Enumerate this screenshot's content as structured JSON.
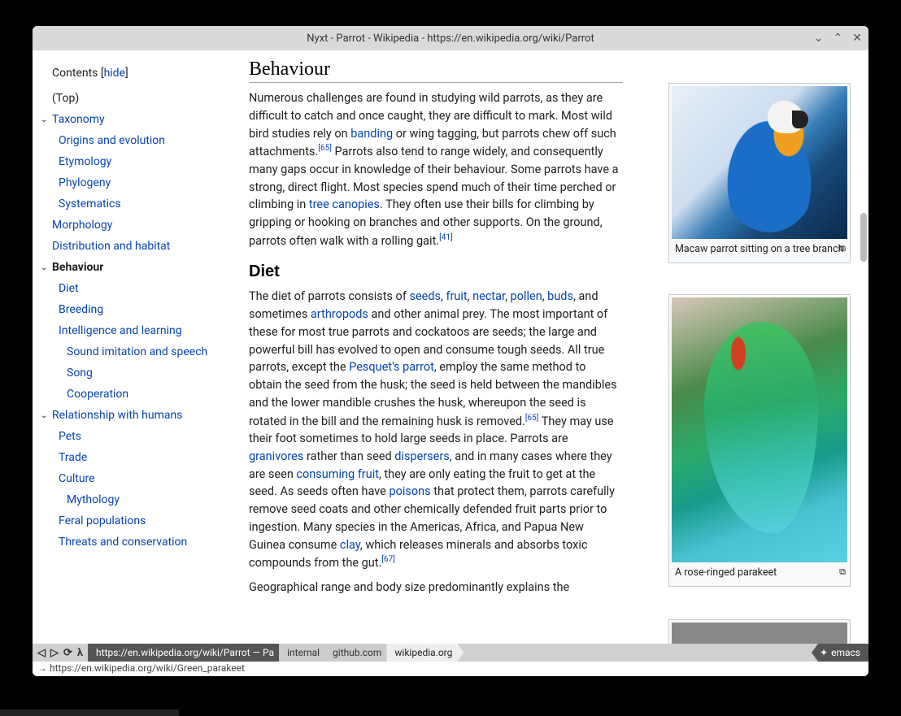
{
  "titlebar": "Nyxt - Parrot - Wikipedia - https://en.wikipedia.org/wiki/Parrot",
  "sidebar": {
    "header": "Contents",
    "hide": "hide",
    "items": [
      {
        "label": "(Top)",
        "lvl": 1,
        "arrow": false,
        "black": true
      },
      {
        "label": "Taxonomy",
        "lvl": 1,
        "arrow": true
      },
      {
        "label": "Origins and evolution",
        "lvl": 2
      },
      {
        "label": "Etymology",
        "lvl": 2
      },
      {
        "label": "Phylogeny",
        "lvl": 2
      },
      {
        "label": "Systematics",
        "lvl": 2
      },
      {
        "label": "Morphology",
        "lvl": 1
      },
      {
        "label": "Distribution and habitat",
        "lvl": 1
      },
      {
        "label": "Behaviour",
        "lvl": 1,
        "arrow": true,
        "bold": true
      },
      {
        "label": "Diet",
        "lvl": 2
      },
      {
        "label": "Breeding",
        "lvl": 2
      },
      {
        "label": "Intelligence and learning",
        "lvl": 2
      },
      {
        "label": "Sound imitation and speech",
        "lvl": 3
      },
      {
        "label": "Song",
        "lvl": 3
      },
      {
        "label": "Cooperation",
        "lvl": 3
      },
      {
        "label": "Relationship with humans",
        "lvl": 1,
        "arrow": true
      },
      {
        "label": "Pets",
        "lvl": 2
      },
      {
        "label": "Trade",
        "lvl": 2
      },
      {
        "label": "Culture",
        "lvl": 2
      },
      {
        "label": "Mythology",
        "lvl": 3
      },
      {
        "label": "Feral populations",
        "lvl": 2
      },
      {
        "label": "Threats and conservation",
        "lvl": 2
      }
    ]
  },
  "headings": {
    "behaviour": "Behaviour",
    "diet": "Diet"
  },
  "para1": {
    "t1": "Numerous challenges are found in studying wild parrots, as they are difficult to catch and once caught, they are difficult to mark. Most wild bird studies rely on ",
    "a1": "banding",
    "t2": " or wing tagging, but parrots chew off such attachments.",
    "ref1": "[65]",
    "t3": " Parrots also tend to range widely, and consequently many gaps occur in knowledge of their behaviour. Some parrots have a strong, direct flight. Most species spend much of their time perched or climbing in ",
    "a2": "tree canopies",
    "t4": ". They often use their bills for climbing by gripping or hooking on branches and other supports. On the ground, parrots often walk with a rolling gait.",
    "ref2": "[41]"
  },
  "para2": {
    "t1": "The diet of parrots consists of ",
    "a1": "seeds",
    "c1": ", ",
    "a2": "fruit",
    "c2": ", ",
    "a3": "nectar",
    "c3": ", ",
    "a4": "pollen",
    "c4": ", ",
    "a5": "buds",
    "t2": ", and sometimes ",
    "a6": "arthropods",
    "t3": " and other animal prey. The most important of these for most true parrots and cockatoos are seeds; the large and powerful bill has evolved to open and consume tough seeds. All true parrots, except the ",
    "a7": "Pesquet's parrot",
    "t4": ", employ the same method to obtain the seed from the husk; the seed is held between the mandibles and the lower mandible crushes the husk, whereupon the seed is rotated in the bill and the remaining husk is removed.",
    "ref1": "[65]",
    "t5": " They may use their foot sometimes to hold large seeds in place. Parrots are ",
    "a8": "granivores",
    "t6": " rather than seed ",
    "a9": "dispersers",
    "t7": ", and in many cases where they are seen ",
    "a10": "consuming fruit",
    "t8": ", they are only eating the fruit to get at the seed. As seeds often have ",
    "a11": "poisons",
    "t9": " that protect them, parrots carefully remove seed coats and other chemically defended fruit parts prior to ingestion. Many species in the Americas, Africa, and Papua New Guinea consume ",
    "a12": "clay",
    "t10": ", which releases minerals and absorbs toxic compounds from the gut.",
    "ref2": "[67]"
  },
  "para3": "Geographical range and body size predominantly explains the",
  "thumbs": {
    "macaw_caption": "Macaw parrot sitting on a tree branch",
    "parakeet_caption": "A rose-ringed parakeet"
  },
  "bottombar": {
    "url_tab": "https://en.wikipedia.org/wiki/Parrot — Pa",
    "tab_internal": "internal",
    "tab_github": "github.com",
    "tab_wikipedia": "wikipedia.org",
    "emacs": "emacs"
  },
  "statusline": "→ https://en.wikipedia.org/wiki/Green_parakeet"
}
